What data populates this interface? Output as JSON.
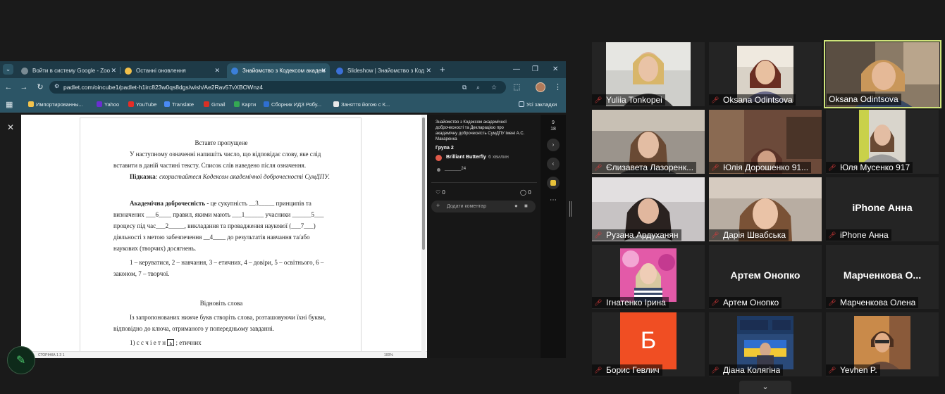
{
  "browser": {
    "tabs": [
      {
        "label": "Войти в систему Google - Zoo",
        "color": "#7a8b94"
      },
      {
        "label": "Останні оновлення",
        "color": "#f2c04a"
      },
      {
        "label": "Знайомство з Кодексом академ",
        "color": "#3b7fd8",
        "active": true
      },
      {
        "label": "Slideshow | Знайомство з Код",
        "color": "#3b6fd8"
      }
    ],
    "url": "padlet.com/oincube1/padlet-h1irc823w0qs8dgs/wish/Ae2Rav57vXBOWnz4",
    "bookmarks": [
      {
        "label": "Импортированны...",
        "color": "#f3c34c"
      },
      {
        "label": "Yahoo",
        "color": "#6a2ed1"
      },
      {
        "label": "YouTube",
        "color": "#e52d27"
      },
      {
        "label": "Translate",
        "color": "#4a8af4"
      },
      {
        "label": "Gmail",
        "color": "#d93025"
      },
      {
        "label": "Карти",
        "color": "#34a853"
      },
      {
        "label": "Сборник ИДЗ Рябу...",
        "color": "#2f6fd0"
      },
      {
        "label": "Заняття йогою с К...",
        "color": "#e8e8e8"
      }
    ],
    "bookmarks_all": "Усі закладки"
  },
  "document": {
    "heading1": "Вставте пропущене",
    "intro_lines": [
      "У наступному означенні напишіть число, що відповідає слову, яке слід",
      "вставити в даній частині тексту. Список слів наведено після означення."
    ],
    "hint_label": "Підказка",
    "hint_text": ": скористайтеся Кодексом академічної доброчесності СумДПУ.",
    "definition_term": "Академічна доброчесність -",
    "definition_lines": [
      "це сукупність __3_____ принципів та",
      "визначених ___6____ правил, якими мають ___1______ учасники ______5___",
      "процесу під час___2_____, викладання та провадження наукової (___7___)",
      "діяльності з метою забезпечення __4____ до результатів навчання та/або",
      "наукових (творчих) досягнень."
    ],
    "word_list": [
      "1 – керуватися,  2 – навчання, 3 – етичних, 4 – довіри, 5 – освітнього, 6 –",
      "законом, 7 – творчої."
    ],
    "heading2": "Відновіть слова",
    "task2_lines": [
      "Із запропонованих нижче букв створіть слова, розташовуючи їхні букви,",
      "відповідно до ключа, отриманого у попередньому завданні."
    ],
    "item1_prefix": "1) с с ч і е т н",
    "item1_box": "ь",
    "item1_suffix": " ;  етичних",
    "status_page": "СТОРІНКА 1 З 1",
    "status_zoom": "100%"
  },
  "padlet_panel": {
    "title_lines": [
      "Знайомство з Кодексом академічної",
      "доброчесності та Декларацією про",
      "академічну доброчесність СумДПУ імені А.С.",
      "Макаренка"
    ],
    "group": "Група 2",
    "author": "Brilliant Butterfly",
    "time": "6 хвилин",
    "attachment": "_______24",
    "likes": "0",
    "comments": "0",
    "comment_placeholder": "Додати коментар",
    "page_current": "9",
    "page_total": "18"
  },
  "participants": [
    {
      "name": "Yuliia Tonkopei",
      "type": "video",
      "muted": true
    },
    {
      "name": "Oksana Odintsova",
      "type": "video",
      "muted": true
    },
    {
      "name": "Oksana Odintsova",
      "type": "video",
      "muted": false,
      "speaking": true
    },
    {
      "name": "Єлизавета Лазоренк...",
      "type": "video",
      "muted": true
    },
    {
      "name": "Юлія Дорошенко 91...",
      "type": "video",
      "muted": true
    },
    {
      "name": "Юля Мусенко 917",
      "type": "video",
      "muted": true
    },
    {
      "name": "Рузана Ардуханян",
      "type": "video",
      "muted": true
    },
    {
      "name": "Дарія Швабська",
      "type": "video",
      "muted": true
    },
    {
      "name": "iPhone Анна",
      "display": "iPhone Анна",
      "type": "name",
      "muted": true
    },
    {
      "name": "Ігнатенко Ірина",
      "type": "video",
      "muted": true
    },
    {
      "name": "Артем Онопко",
      "display": "Артем Онопко",
      "type": "name",
      "muted": true
    },
    {
      "name": "Марченкова Олена",
      "display": "Марченкова  О...",
      "type": "name",
      "muted": true
    },
    {
      "name": "Борис Гевлич",
      "letter": "Б",
      "type": "letter",
      "muted": true
    },
    {
      "name": "Діана Колягіна",
      "type": "video",
      "muted": true
    },
    {
      "name": "Yevhen P.",
      "type": "video",
      "muted": true
    }
  ]
}
